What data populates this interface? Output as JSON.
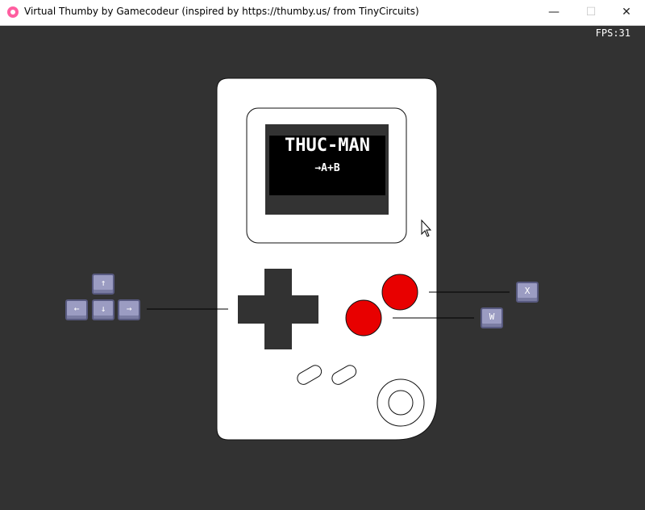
{
  "window": {
    "title": "Virtual Thumby by Gamecodeur (inspired by https://thumby.us/ from TinyCircuits)",
    "minimize_icon": "minimize-icon",
    "maximize_icon": "maximize-icon",
    "close_icon": "close-icon"
  },
  "hud": {
    "fps": "FPS:31"
  },
  "game_screen": {
    "title": "THUC-MAN",
    "subtitle": "→A+B"
  },
  "keys": {
    "up": "↑",
    "left": "←",
    "down": "↓",
    "right": "→",
    "x": "X",
    "w": "W"
  },
  "colors": {
    "background": "#323232",
    "console_body": "#ffffff",
    "dpad": "#323232",
    "buttons": "#e80000",
    "keycap": "#9b9cc2"
  }
}
